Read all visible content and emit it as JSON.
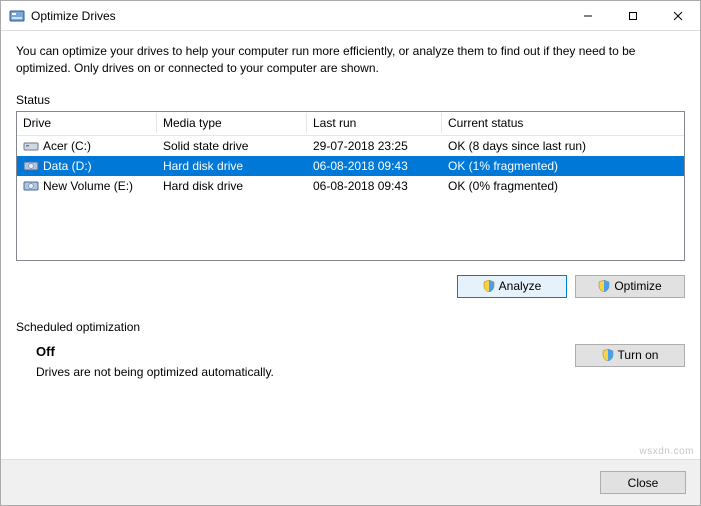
{
  "window": {
    "title": "Optimize Drives",
    "description": "You can optimize your drives to help your computer run more efficiently, or analyze them to find out if they need to be optimized. Only drives on or connected to your computer are shown."
  },
  "status": {
    "label": "Status",
    "columns": {
      "drive": "Drive",
      "media": "Media type",
      "run": "Last run",
      "status": "Current status"
    },
    "rows": [
      {
        "name": "Acer (C:)",
        "media": "Solid state drive",
        "run": "29-07-2018 23:25",
        "status": "OK (8 days since last run)",
        "selected": false,
        "icon": "ssd"
      },
      {
        "name": "Data (D:)",
        "media": "Hard disk drive",
        "run": "06-08-2018 09:43",
        "status": "OK (1% fragmented)",
        "selected": true,
        "icon": "hdd"
      },
      {
        "name": "New Volume (E:)",
        "media": "Hard disk drive",
        "run": "06-08-2018 09:43",
        "status": "OK (0% fragmented)",
        "selected": false,
        "icon": "hdd"
      }
    ]
  },
  "buttons": {
    "analyze": "Analyze",
    "optimize": "Optimize",
    "turn_on": "Turn on",
    "close": "Close"
  },
  "schedule": {
    "label": "Scheduled optimization",
    "state": "Off",
    "desc": "Drives are not being optimized automatically."
  },
  "watermark": "wsxdn.com"
}
